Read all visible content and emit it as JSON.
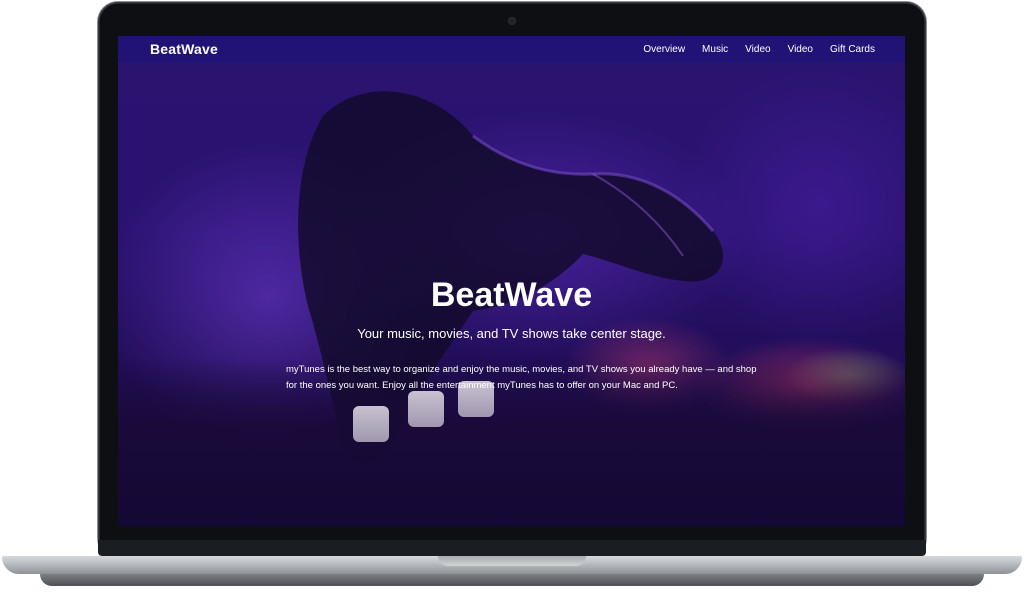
{
  "nav": {
    "brand": "BeatWave",
    "links": [
      "Overview",
      "Music",
      "Video",
      "Video",
      "Gift Cards"
    ]
  },
  "hero": {
    "title": "BeatWave",
    "subtitle": "Your music, movies, and TV shows take center stage.",
    "description": "myTunes is the best way to organize and enjoy the music, movies, and TV shows you already have — and shop for the ones you want. Enjoy all the entertainment myTunes has to offer on your Mac and PC."
  },
  "colors": {
    "navbar": "#211376",
    "hero_tint": "#2a1470",
    "text": "#ffffff"
  }
}
